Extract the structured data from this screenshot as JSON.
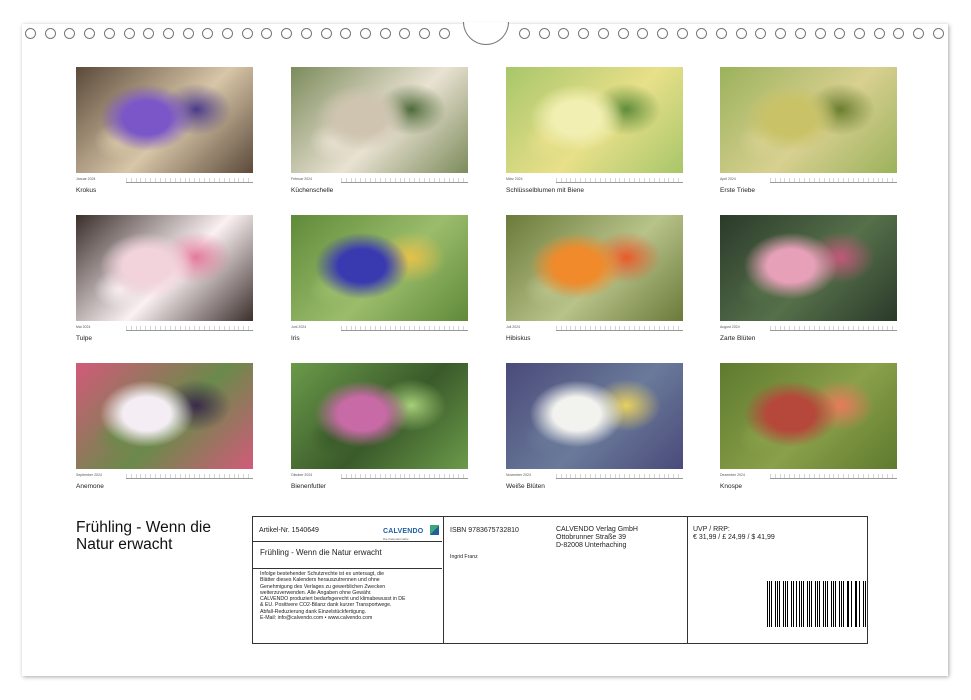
{
  "months": [
    {
      "month_label": "Januar 2024",
      "caption": "Krokus",
      "palette": [
        "#5b4a3a",
        "#7a56c8",
        "#4a3a8a",
        "#d8c6a8"
      ]
    },
    {
      "month_label": "Februar 2024",
      "caption": "Küchenschelle",
      "palette": [
        "#7c8b5c",
        "#cfc4b0",
        "#4f6b3a",
        "#e9e2d2"
      ]
    },
    {
      "month_label": "März 2024",
      "caption": "Schlüsselblumen mit Biene",
      "palette": [
        "#a8c66a",
        "#f1efb1",
        "#5f8d3a",
        "#e8e08a"
      ]
    },
    {
      "month_label": "April 2024",
      "caption": "Erste Triebe",
      "palette": [
        "#9bb25c",
        "#c9c267",
        "#6b7e2f",
        "#d8d090"
      ]
    },
    {
      "month_label": "Mai 2024",
      "caption": "Tulpe",
      "palette": [
        "#3b2f2c",
        "#f2d3dc",
        "#e27a9a",
        "#fbf1f2"
      ]
    },
    {
      "month_label": "Juni 2024",
      "caption": "Iris",
      "palette": [
        "#5f8a3a",
        "#3a3ab0",
        "#e5c04a",
        "#9bbd6b"
      ]
    },
    {
      "month_label": "Juli 2024",
      "caption": "Hibiskus",
      "palette": [
        "#6b7a3a",
        "#f08a2a",
        "#e95a2a",
        "#b8c38a"
      ]
    },
    {
      "month_label": "August 2024",
      "caption": "Zarte Blüten",
      "palette": [
        "#2a3a2a",
        "#e6a0b8",
        "#c2587a",
        "#56704a"
      ]
    },
    {
      "month_label": "September 2024",
      "caption": "Anemone",
      "palette": [
        "#d25a7a",
        "#f4eef4",
        "#3a2a4a",
        "#6a8a4a"
      ]
    },
    {
      "month_label": "Oktober 2024",
      "caption": "Bienenfutter",
      "palette": [
        "#6a9a4a",
        "#c86aa6",
        "#a8cf7a",
        "#3a5a2a"
      ]
    },
    {
      "month_label": "November 2024",
      "caption": "Weiße Blüten",
      "palette": [
        "#4a4a7a",
        "#f2f2ee",
        "#e8d060",
        "#6a7a9a"
      ]
    },
    {
      "month_label": "Dezember 2024",
      "caption": "Knospe",
      "palette": [
        "#5e7a2e",
        "#b5483a",
        "#e87a5a",
        "#8aa04a"
      ]
    }
  ],
  "title": "Frühling - Wenn die Natur erwacht",
  "info": {
    "article_no": "Artikel-Nr. 1540649",
    "subtitle": "Frühling - Wenn die Natur erwacht",
    "legal": [
      "Infolge bestehender Schutzrechte ist es untersagt, die",
      "Blätter dieses Kalenders herauszutrennen und ohne",
      "Genehmigung des Verlages zu gewerblichen Zwecken",
      "weiterzuverwenden. Alle Angaben ohne Gewähr.",
      " CALVENDO produziert bedarfsgerecht und klimabewusst in DE",
      "& EU. Positivere CO2-Bilanz dank kurzer Transportwege.",
      "Abfall-Reduzierung dank Einzelstückfertigung.",
      " E-Mail: info@calvendo.com • www.calvendo.com"
    ],
    "isbn": "ISBN 9783675732810",
    "author": "Ingrid Franz",
    "publisher": [
      "CALVENDO Verlag GmbH",
      "Ottobrunner Straße 39",
      "D-82008 Unterhaching"
    ],
    "price_label": "UVP / RRP:",
    "price_values": "€ 31,99 / £ 24,99 / $ 41,99",
    "logo_text": "CALVENDO",
    "logo_tagline": "Die Kalendermarke",
    "brand_color": "#3aa87a"
  }
}
